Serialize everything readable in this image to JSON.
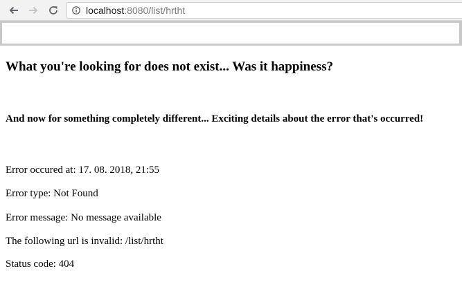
{
  "browser": {
    "icons": {
      "back": "arrow-left-icon",
      "forward": "arrow-right-icon",
      "reload": "reload-icon",
      "site_info": "info-circle-icon"
    },
    "address_bar": {
      "host": "localhost",
      "rest": ":8080/list/hrtht"
    }
  },
  "page": {
    "input_value": "",
    "heading": "What you're looking for does not exist... Was it happiness?",
    "subheading": "And now for something completely different... Exciting details about the error that's occurred!",
    "details": [
      {
        "label": "Error occured at:",
        "value": "17. 08. 2018, 21:55"
      },
      {
        "label": "Error type:",
        "value": "Not Found"
      },
      {
        "label": "Error message:",
        "value": "No message available"
      },
      {
        "label": "The following url is invalid:",
        "value": "/list/hrtht"
      },
      {
        "label": "Status code:",
        "value": "404"
      }
    ]
  },
  "colors": {
    "toolbar_bg": "#f2f2f2",
    "input_frame": "#c8c8c8",
    "url_host": "#202020",
    "url_rest": "#7a7a7a",
    "nav_enabled": "#5f6368",
    "nav_disabled": "#c4c4c4"
  }
}
